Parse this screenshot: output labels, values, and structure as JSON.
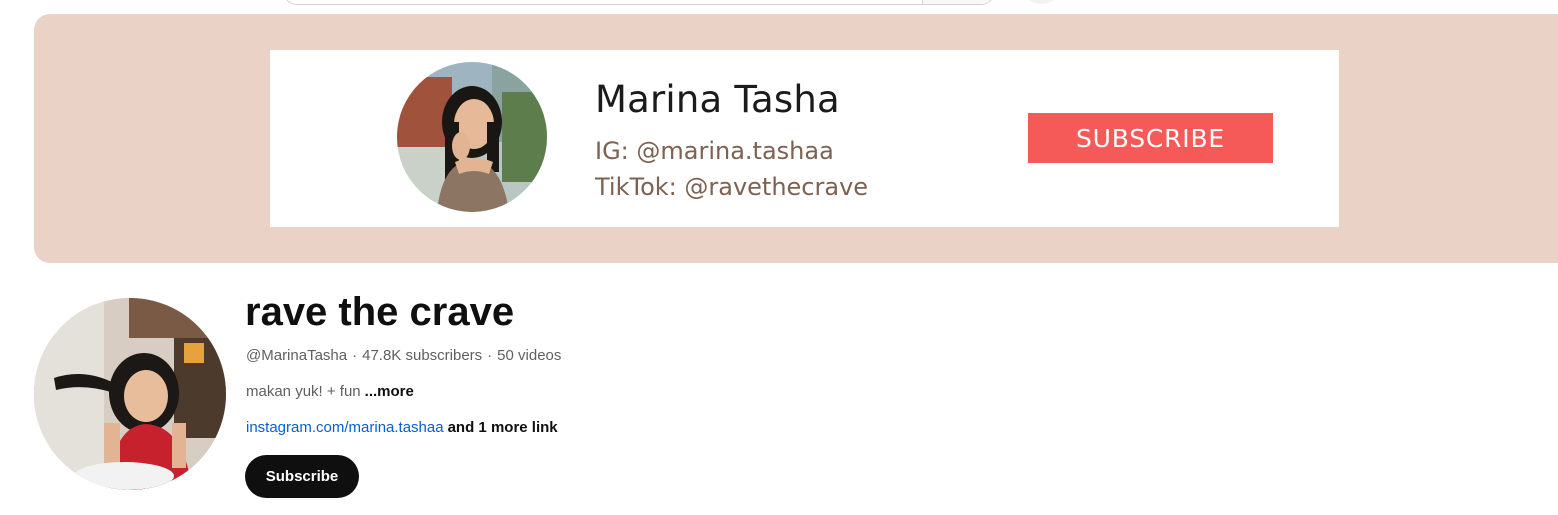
{
  "banner": {
    "name": "Marina Tasha",
    "ig": "IG: @marina.tashaa",
    "tiktok": "TikTok: @ravethecrave",
    "subscribe_label": "SUBSCRIBE",
    "background_color": "#ebd2c6",
    "button_color": "#f55a58"
  },
  "channel": {
    "title": "rave the crave",
    "handle": "@MarinaTasha",
    "subscribers": "47.8K subscribers",
    "videos": "50 videos",
    "separator": "·",
    "description": "makan yuk! + fun",
    "more_label": "...more",
    "link": "instagram.com/marina.tashaa",
    "more_links": "and 1 more link",
    "subscribe_label": "Subscribe",
    "link_color": "#065fd4"
  }
}
